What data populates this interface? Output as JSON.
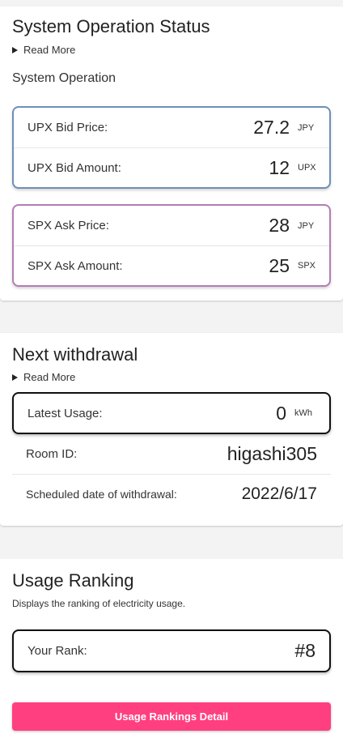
{
  "system": {
    "title": "System Operation Status",
    "read_more": "Read More",
    "subhead": "System Operation",
    "upx": [
      {
        "label": "UPX Bid Price:",
        "value": "27.2",
        "unit": "JPY"
      },
      {
        "label": "UPX Bid Amount:",
        "value": "12",
        "unit": "UPX"
      }
    ],
    "spx": [
      {
        "label": "SPX Ask Price:",
        "value": "28",
        "unit": "JPY"
      },
      {
        "label": "SPX Ask Amount:",
        "value": "25",
        "unit": "SPX"
      }
    ]
  },
  "withdrawal": {
    "title": "Next withdrawal",
    "read_more": "Read More",
    "latest_usage": {
      "label": "Latest Usage:",
      "value": "0",
      "unit": "kWh"
    },
    "room_id": {
      "label": "Room ID:",
      "value": "higashi305"
    },
    "scheduled": {
      "label": "Scheduled date of withdrawal:",
      "value": "2022/6/17"
    }
  },
  "ranking": {
    "title": "Usage Ranking",
    "description": "Displays the ranking of electricity usage.",
    "rank": {
      "label": "Your Rank:",
      "value": "#8"
    },
    "button_label": "Usage Rankings Detail"
  },
  "colors": {
    "upx_border": "#6f8fb9",
    "spx_border": "#b37db6",
    "accent_button": "#ff3f80"
  }
}
